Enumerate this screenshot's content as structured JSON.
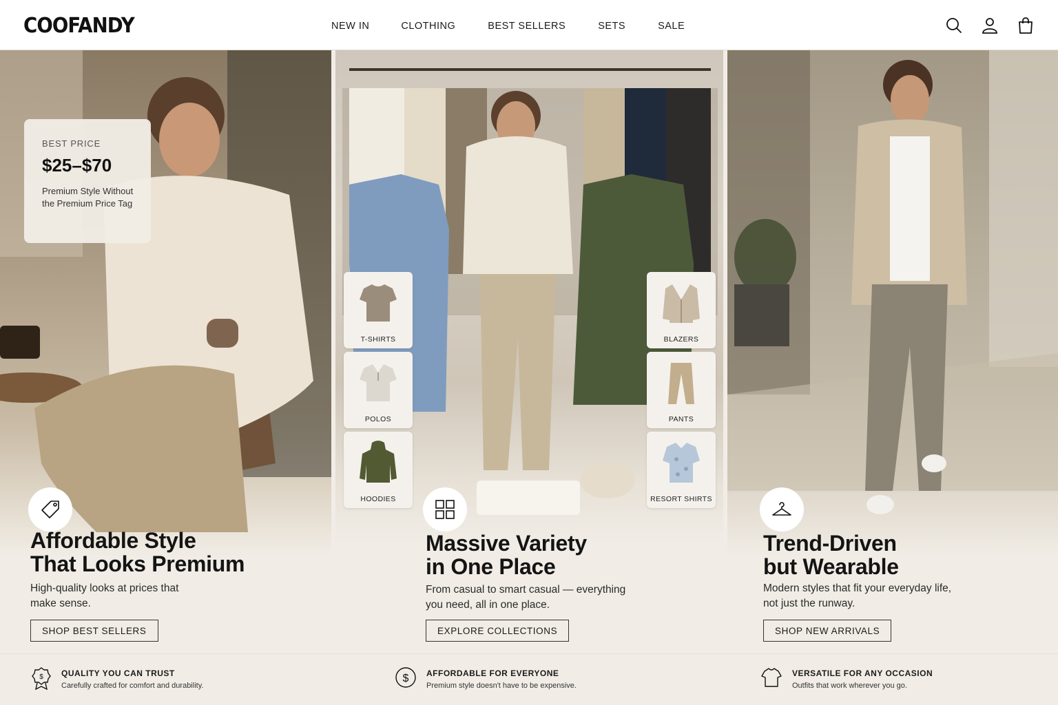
{
  "brand": {
    "logo": "COOFANDY"
  },
  "nav": {
    "items": [
      "NEW IN",
      "CLOTHING",
      "BEST SELLERS",
      "SETS",
      "SALE"
    ]
  },
  "header_icons": [
    "search-icon",
    "account-icon",
    "bag-icon"
  ],
  "panels": {
    "affordable": {
      "price_card": {
        "label": "BEST PRICE",
        "value": "$25–$70",
        "subtitle": "Premium Style Without the Premium Price Tag"
      },
      "icon": "tag-icon",
      "headline_1": "Affordable Style",
      "headline_2": "That Looks Premium",
      "description": "High-quality looks at prices that make sense.",
      "cta": "SHOP BEST SELLERS"
    },
    "variety": {
      "tiles_left": [
        "T-SHIRTS",
        "POLOS",
        "HOODIES"
      ],
      "tiles_right": [
        "BLAZERS",
        "PANTS",
        "RESORT SHIRTS"
      ],
      "icon": "grid-icon",
      "headline_1": "Massive Variety",
      "headline_2": "in One Place",
      "description": "From casual to smart casual — everything you need, all in one place.",
      "cta": "EXPLORE COLLECTIONS"
    },
    "trend": {
      "icon": "hanger-icon",
      "headline_1": "Trend-Driven",
      "headline_2": "but Wearable",
      "description": "Modern styles that fit your everyday life, not just the runway.",
      "cta": "SHOP NEW ARRIVALS"
    }
  },
  "features": [
    {
      "icon": "quality-badge-icon",
      "title": "QUALITY YOU CAN TRUST",
      "subtitle": "Carefully crafted for comfort and durability."
    },
    {
      "icon": "dollar-icon",
      "title": "AFFORDABLE FOR EVERYONE",
      "subtitle": "Premium style doesn't have to be expensive."
    },
    {
      "icon": "tshirt-icon",
      "title": "VERSATILE FOR ANY OCCASION",
      "subtitle": "Outfits that work wherever you go."
    }
  ],
  "colors": {
    "background": "#f1ede6",
    "text": "#1a1a1a",
    "header": "#ffffff"
  }
}
